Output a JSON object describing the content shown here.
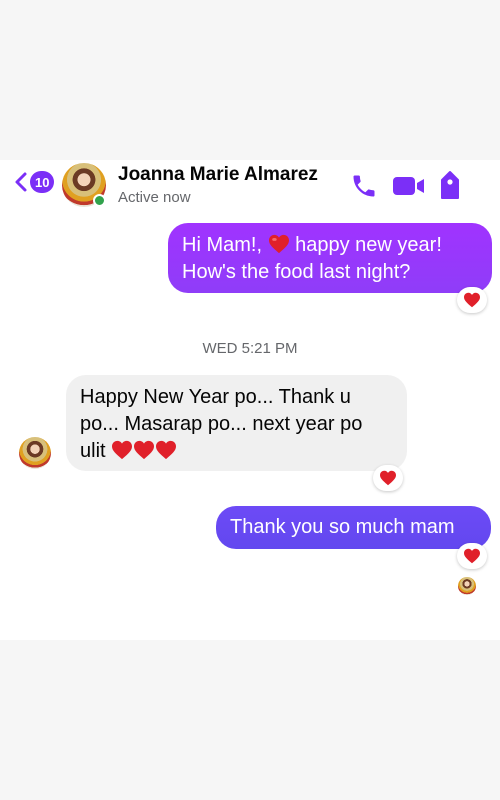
{
  "header": {
    "back_count": "10",
    "name": "Joanna Marie Almarez",
    "status": "Active now",
    "icons": [
      "chevron-left-icon",
      "phone-icon",
      "video-camera-icon",
      "info-icon"
    ]
  },
  "messages": [
    {
      "direction": "outgoing",
      "line1_pre": "Hi Mam!,",
      "line1_post": "happy new year!",
      "line2": "How's the food last night?",
      "reaction": "heart"
    },
    {
      "direction": "incoming",
      "line1": "Happy New Year po... Thank u",
      "line2": "po... Masarap po... next year po",
      "line3": "ulit",
      "hearts": 3,
      "reaction": "heart"
    },
    {
      "direction": "outgoing",
      "text": "Thank you so much mam",
      "reaction": "heart"
    }
  ],
  "timestamp": "WED 5:21 PM",
  "colors": {
    "accent": "#7b2ff7",
    "outgoing_1": "#9a37fd",
    "outgoing_2": "#6848f3",
    "incoming": "#f0f0f0",
    "heart": "#e0202a",
    "online": "#31a24c"
  }
}
